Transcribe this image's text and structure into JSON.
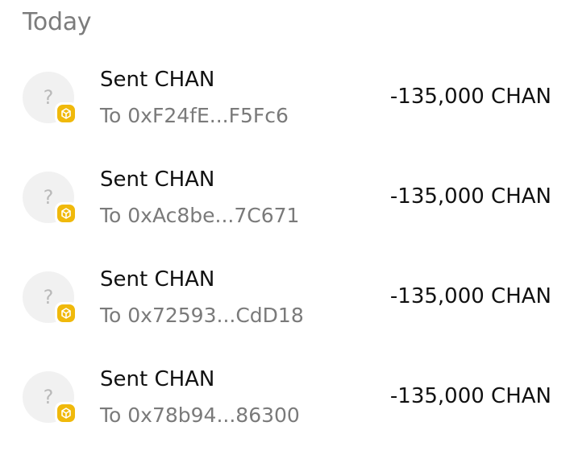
{
  "section": {
    "title": "Today"
  },
  "badge_color": "#F0B90B",
  "transactions": [
    {
      "title": "Sent CHAN",
      "subtitle": "To 0xF24fE...F5Fc6",
      "amount": "-135,000 CHAN",
      "avatar_glyph": "?",
      "chain_icon": "bnb-chain-icon"
    },
    {
      "title": "Sent CHAN",
      "subtitle": "To 0xAc8be...7C671",
      "amount": "-135,000 CHAN",
      "avatar_glyph": "?",
      "chain_icon": "bnb-chain-icon"
    },
    {
      "title": "Sent CHAN",
      "subtitle": "To 0x72593...CdD18",
      "amount": "-135,000 CHAN",
      "avatar_glyph": "?",
      "chain_icon": "bnb-chain-icon"
    },
    {
      "title": "Sent CHAN",
      "subtitle": "To 0x78b94...86300",
      "amount": "-135,000 CHAN",
      "avatar_glyph": "?",
      "chain_icon": "bnb-chain-icon"
    }
  ]
}
